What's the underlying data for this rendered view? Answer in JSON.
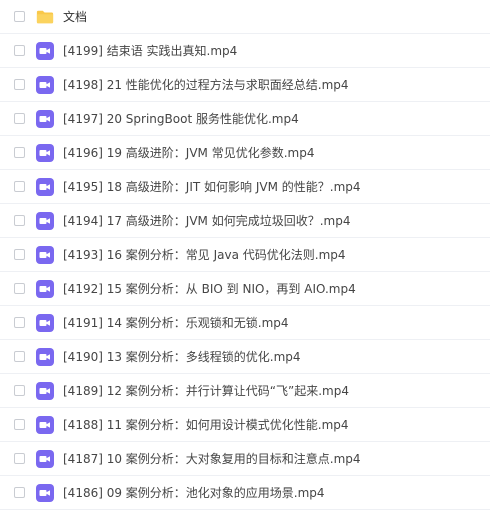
{
  "colors": {
    "folder_icon": "#f9c84a",
    "video_icon": "#7a68f0",
    "text": "#454545",
    "separator": "#eef0f4"
  },
  "files": [
    {
      "name": "文档",
      "type": "folder",
      "icon": "folder-icon"
    },
    {
      "name": "[4199] 结束语 实践出真知.mp4",
      "type": "video",
      "icon": "video-icon"
    },
    {
      "name": "[4198] 21 性能优化的过程方法与求职面经总结.mp4",
      "type": "video",
      "icon": "video-icon"
    },
    {
      "name": "[4197] 20 SpringBoot 服务性能优化.mp4",
      "type": "video",
      "icon": "video-icon"
    },
    {
      "name": "[4196] 19 高级进阶：JVM 常见优化参数.mp4",
      "type": "video",
      "icon": "video-icon"
    },
    {
      "name": "[4195] 18 高级进阶：JIT 如何影响 JVM 的性能？.mp4",
      "type": "video",
      "icon": "video-icon"
    },
    {
      "name": "[4194] 17 高级进阶：JVM 如何完成垃圾回收？.mp4",
      "type": "video",
      "icon": "video-icon"
    },
    {
      "name": "[4193] 16 案例分析：常见 Java 代码优化法则.mp4",
      "type": "video",
      "icon": "video-icon"
    },
    {
      "name": "[4192] 15 案例分析：从 BIO 到 NIO，再到 AIO.mp4",
      "type": "video",
      "icon": "video-icon"
    },
    {
      "name": "[4191] 14 案例分析：乐观锁和无锁.mp4",
      "type": "video",
      "icon": "video-icon"
    },
    {
      "name": "[4190] 13 案例分析：多线程锁的优化.mp4",
      "type": "video",
      "icon": "video-icon"
    },
    {
      "name": "[4189] 12 案例分析：并行计算让代码“飞”起来.mp4",
      "type": "video",
      "icon": "video-icon"
    },
    {
      "name": "[4188] 11 案例分析：如何用设计模式优化性能.mp4",
      "type": "video",
      "icon": "video-icon"
    },
    {
      "name": "[4187] 10 案例分析：大对象复用的目标和注意点.mp4",
      "type": "video",
      "icon": "video-icon"
    },
    {
      "name": "[4186] 09 案例分析：池化对象的应用场景.mp4",
      "type": "video",
      "icon": "video-icon"
    }
  ]
}
